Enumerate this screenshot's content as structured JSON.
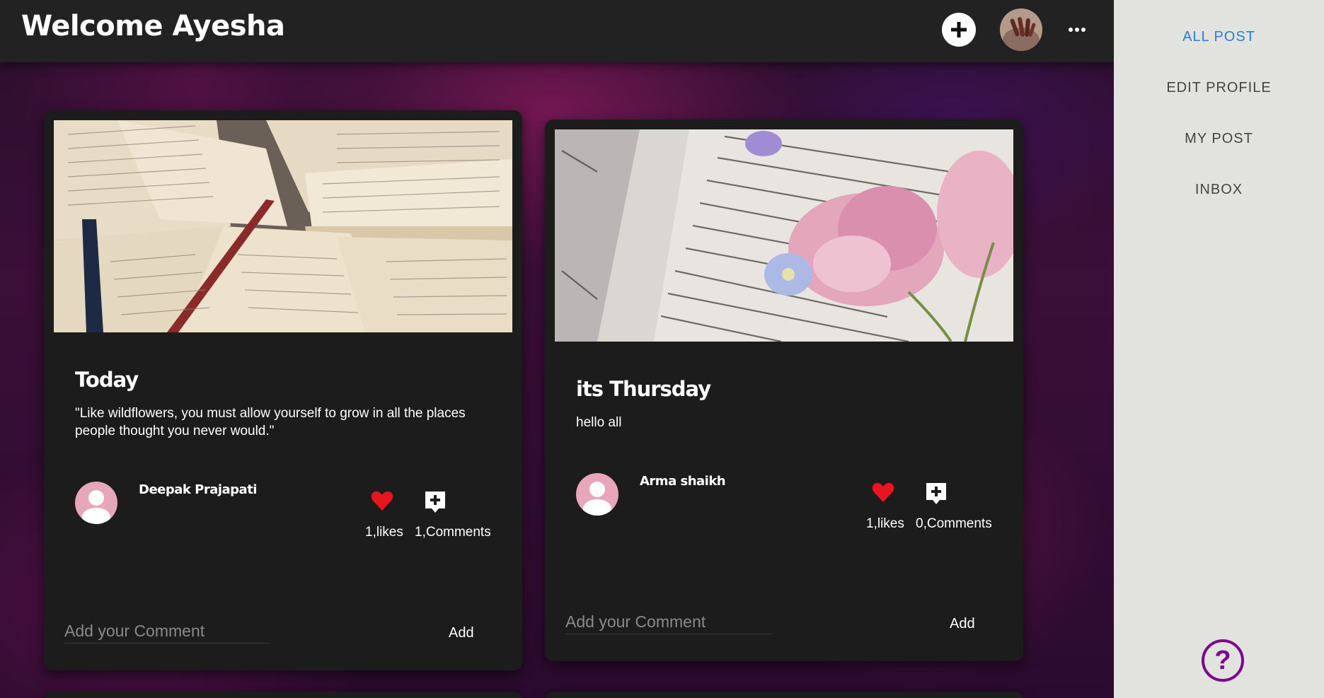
{
  "header": {
    "title": "Welcome Ayesha",
    "add_icon": "plus-circle-icon",
    "avatar_icon": "user-avatar",
    "more_icon": "more-dots-icon"
  },
  "sidebar": {
    "items": [
      {
        "label": "ALL POST",
        "active": true
      },
      {
        "label": "EDIT PROFILE",
        "active": false
      },
      {
        "label": "MY POST",
        "active": false
      },
      {
        "label": "INBOX",
        "active": false
      }
    ],
    "help_icon": "question-mark-icon",
    "help_label": "?"
  },
  "posts": [
    {
      "title": "Today",
      "text": "\"Like wildflowers, you must allow yourself to grow in all the places people thought you never would.\"",
      "author": "Deepak Prajapati",
      "likes": "1,likes",
      "comments": "1,Comments",
      "comment_placeholder": "Add your Comment",
      "add_label": "Add",
      "image": "open-books-photo"
    },
    {
      "title": "its Thursday",
      "text": "hello all",
      "author": "Arma shaikh",
      "likes": "1,likes",
      "comments": "0,Comments",
      "comment_placeholder": "Add your Comment",
      "add_label": "Add",
      "image": "book-with-pink-flowers-photo"
    }
  ],
  "colors": {
    "header_bg": "#222222",
    "card_bg": "#1c1c1c",
    "sidebar_bg": "#e2e2df",
    "active_link": "#2f7bd1",
    "heart": "#e8141e",
    "help_purple": "#7a0a8a",
    "avatar_pink": "#e8a6bb"
  }
}
